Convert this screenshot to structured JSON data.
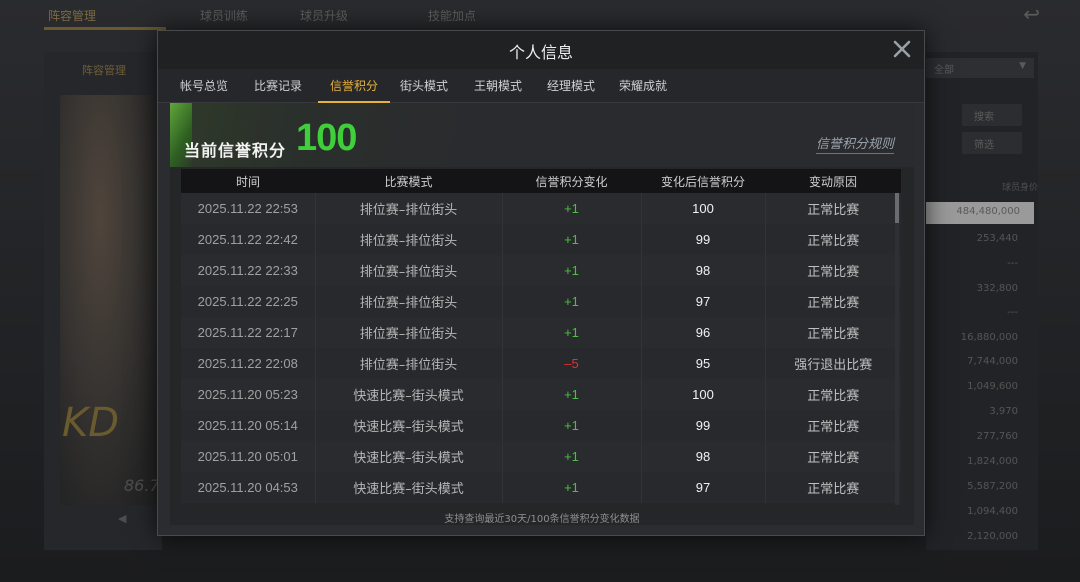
{
  "background": {
    "tabs": [
      "阵容管理",
      "球员训练",
      "球员升级",
      "技能加点"
    ],
    "left_panel_title": "阵容管理",
    "player_number_text": "86.7",
    "player_sig": "KD",
    "right_select": "全部",
    "right_buttons": [
      "搜索",
      "筛选"
    ],
    "right_header": "球员身价",
    "right_values": [
      "484,480,000",
      "253,440",
      "---",
      "332,800",
      "---",
      "16,880,000",
      "7,744,000",
      "1,049,600",
      "3,970",
      "277,760",
      "1,824,000",
      "5,587,200",
      "1,094,400",
      "2,120,000"
    ]
  },
  "modal": {
    "title": "个人信息",
    "tabs": [
      {
        "label": "帐号总览"
      },
      {
        "label": "比赛记录"
      },
      {
        "label": "信誉积分"
      },
      {
        "label": "街头模式"
      },
      {
        "label": "王朝模式"
      },
      {
        "label": "经理模式"
      },
      {
        "label": "荣耀成就"
      }
    ],
    "active_tab": "信誉积分",
    "score_label": "当前信誉积分",
    "score_value": "100",
    "rules_link": "信誉积分规则",
    "columns": [
      "时间",
      "比赛模式",
      "信誉积分变化",
      "变化后信誉积分",
      "变动原因"
    ],
    "rows": [
      {
        "time": "2025.11.22  22:53",
        "mode": "排位赛–排位街头",
        "change": "+1",
        "after": "100",
        "reason": "正常比赛"
      },
      {
        "time": "2025.11.22  22:42",
        "mode": "排位赛–排位街头",
        "change": "+1",
        "after": "99",
        "reason": "正常比赛"
      },
      {
        "time": "2025.11.22  22:33",
        "mode": "排位赛–排位街头",
        "change": "+1",
        "after": "98",
        "reason": "正常比赛"
      },
      {
        "time": "2025.11.22  22:25",
        "mode": "排位赛–排位街头",
        "change": "+1",
        "after": "97",
        "reason": "正常比赛"
      },
      {
        "time": "2025.11.22  22:17",
        "mode": "排位赛–排位街头",
        "change": "+1",
        "after": "96",
        "reason": "正常比赛"
      },
      {
        "time": "2025.11.22  22:08",
        "mode": "排位赛–排位街头",
        "change": "–5",
        "after": "95",
        "reason": "强行退出比赛"
      },
      {
        "time": "2025.11.20  05:23",
        "mode": "快速比赛–街头模式",
        "change": "+1",
        "after": "100",
        "reason": "正常比赛"
      },
      {
        "time": "2025.11.20  05:14",
        "mode": "快速比赛–街头模式",
        "change": "+1",
        "after": "99",
        "reason": "正常比赛"
      },
      {
        "time": "2025.11.20  05:01",
        "mode": "快速比赛–街头模式",
        "change": "+1",
        "after": "98",
        "reason": "正常比赛"
      },
      {
        "time": "2025.11.20  04:53",
        "mode": "快速比赛–街头模式",
        "change": "+1",
        "after": "97",
        "reason": "正常比赛"
      }
    ],
    "footer_note": "支持查询最近30天/100条信誉积分变化数据",
    "colors": {
      "accent": "#e7b13a",
      "positive": "#48c23e",
      "negative": "#d8372f",
      "score": "#3fcf3a"
    }
  }
}
